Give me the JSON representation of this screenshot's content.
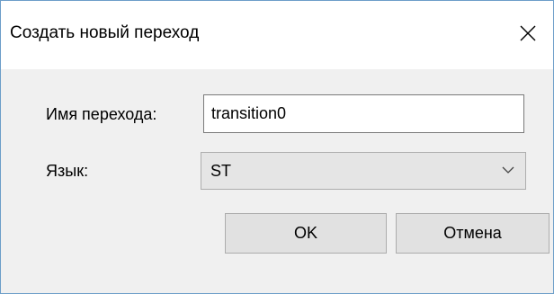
{
  "dialog": {
    "title": "Создать новый переход",
    "close_icon": "close-icon"
  },
  "form": {
    "name_label": "Имя перехода:",
    "name_value": "transition0",
    "language_label": "Язык:",
    "language_value": "ST",
    "language_dropdown_icon": "chevron-down-icon"
  },
  "buttons": {
    "ok_label": "OK",
    "cancel_label": "Отмена"
  }
}
